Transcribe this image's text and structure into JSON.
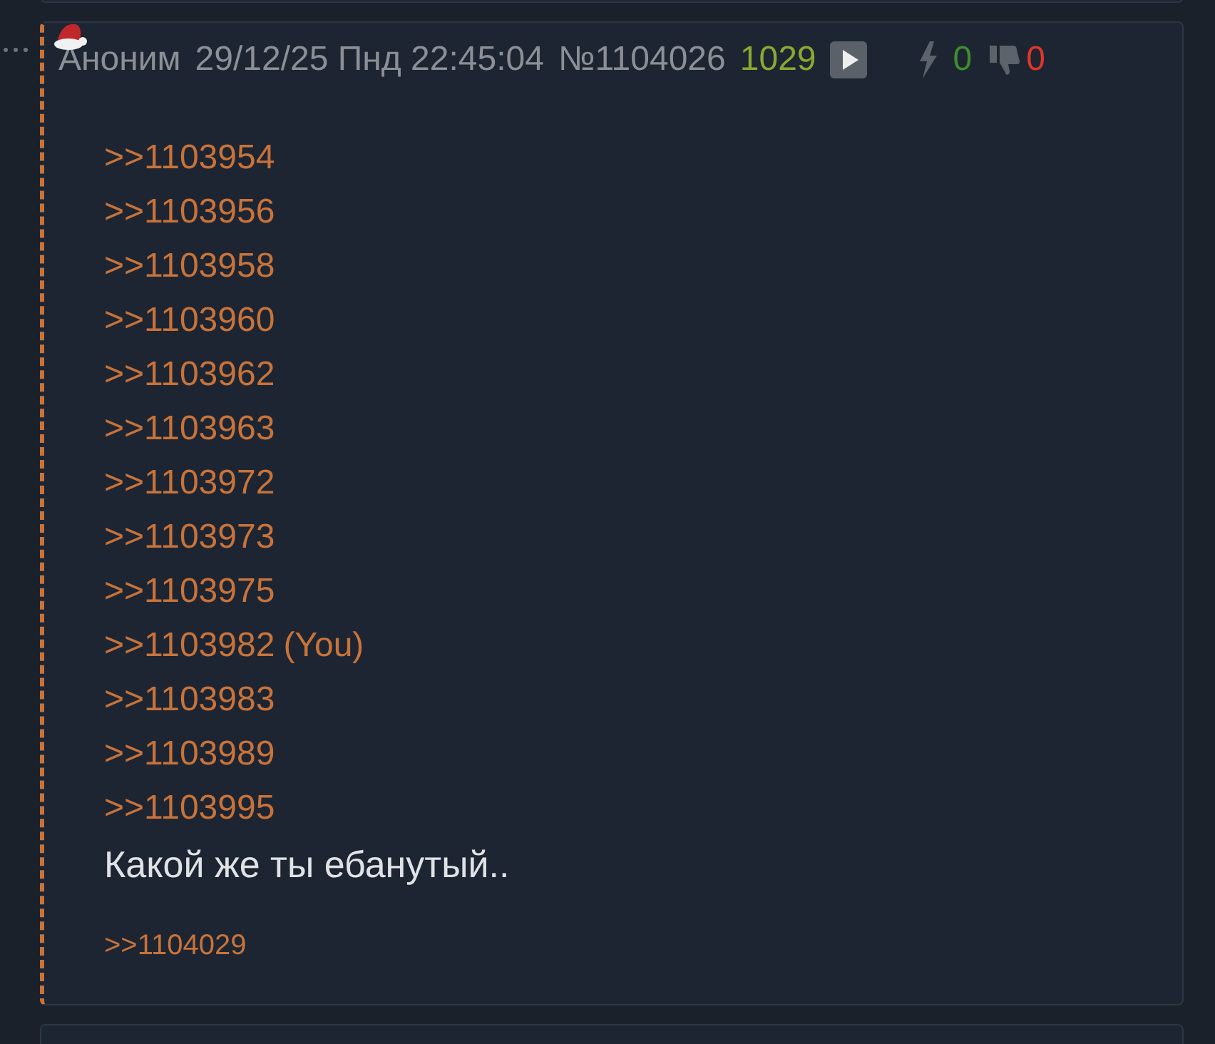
{
  "post": {
    "author": "Аноним",
    "date": "29/12/25 Пнд 22:45:04",
    "number": "№1104026",
    "count": "1029",
    "likes": "0",
    "dislikes": "0",
    "links": [
      {
        "text": ">>1103954"
      },
      {
        "text": ">>1103956"
      },
      {
        "text": ">>1103958"
      },
      {
        "text": ">>1103960"
      },
      {
        "text": ">>1103962"
      },
      {
        "text": ">>1103963"
      },
      {
        "text": ">>1103972"
      },
      {
        "text": ">>1103973"
      },
      {
        "text": ">>1103975"
      },
      {
        "text": ">>1103982",
        "you": "(You)"
      },
      {
        "text": ">>1103983"
      },
      {
        "text": ">>1103989"
      },
      {
        "text": ">>1103995"
      }
    ],
    "message": "Какой же ты ебанутый..",
    "backlinks": [
      ">>1104029"
    ]
  }
}
